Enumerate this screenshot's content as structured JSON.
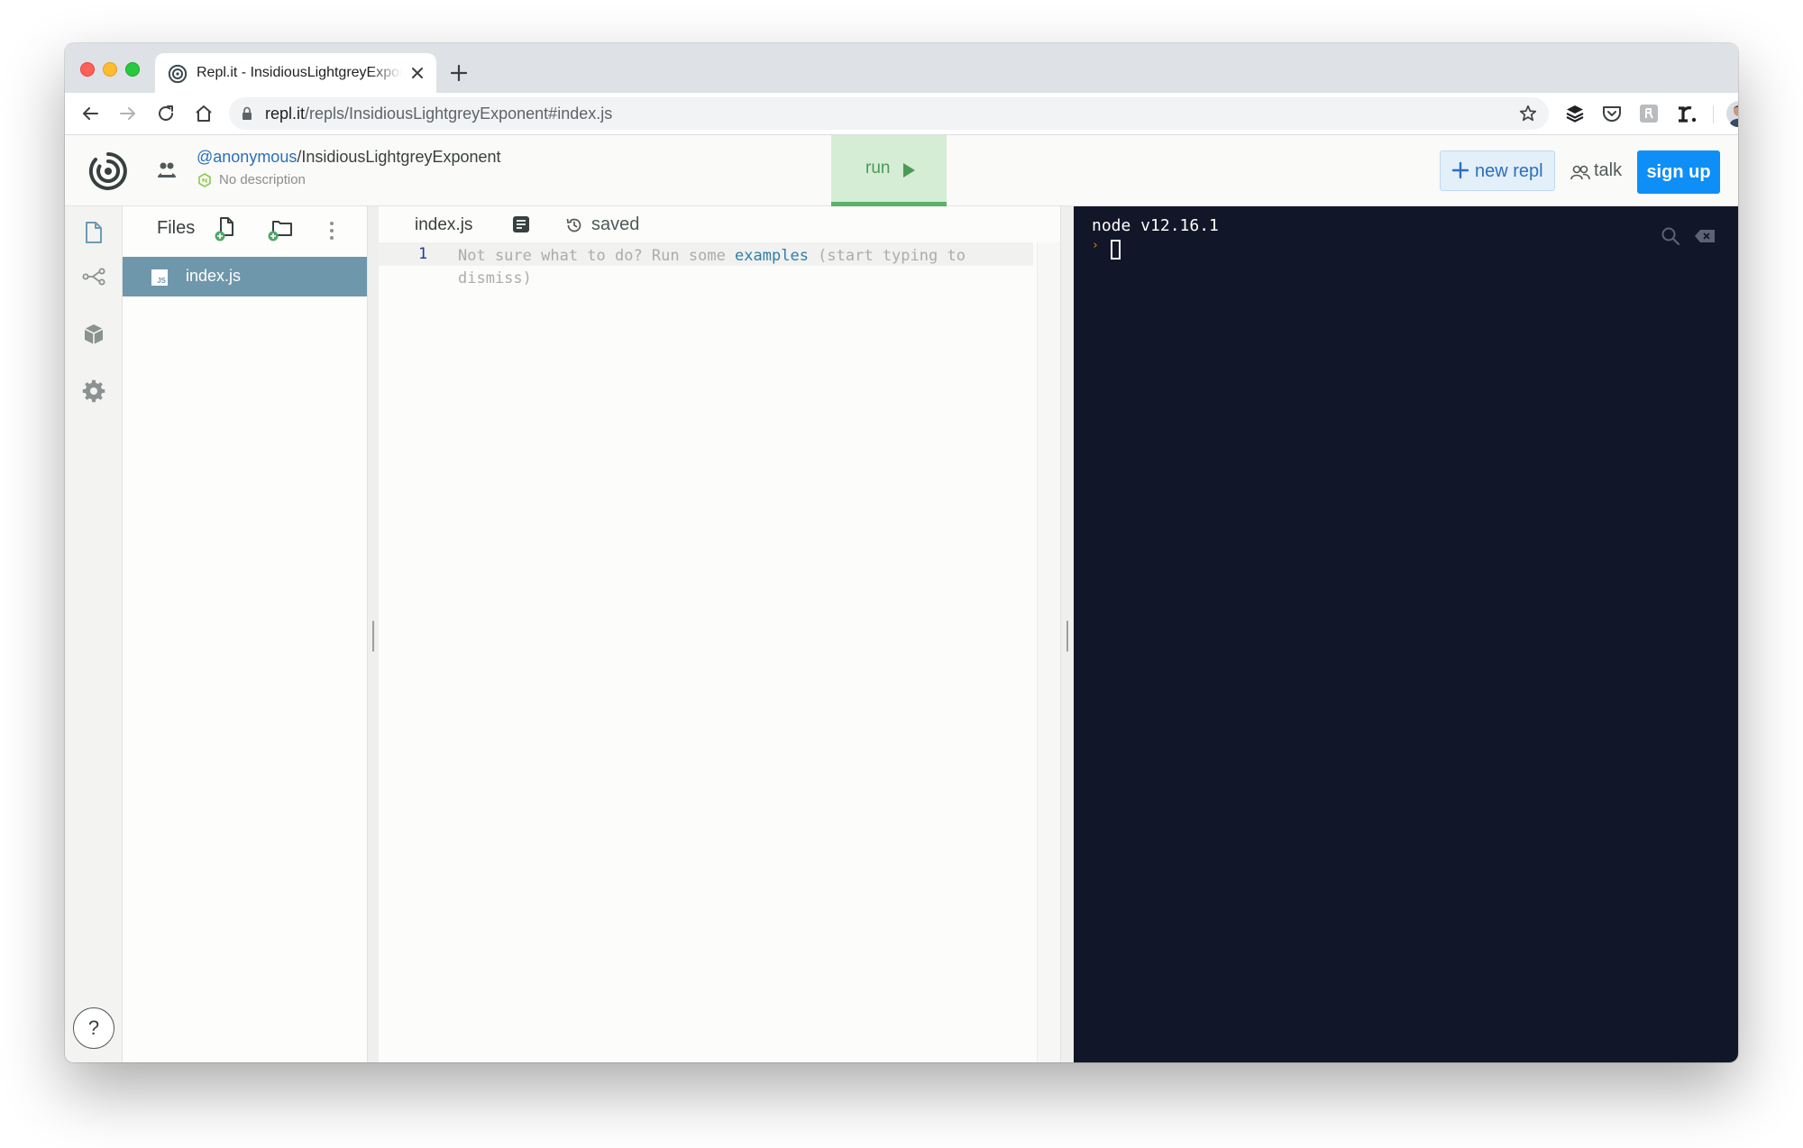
{
  "browser": {
    "tab_title": "Repl.it - InsidiousLightgreyExponent",
    "url_host": "repl.it",
    "url_path": "/repls/InsidiousLightgreyExponent#index.js"
  },
  "header": {
    "owner": "@anonymous",
    "separator": "/",
    "repl_name": "InsidiousLightgreyExponent",
    "description": "No description",
    "run_label": "run",
    "new_repl_label": "new repl",
    "talk_label": "talk",
    "sign_up_label": "sign up"
  },
  "files": {
    "title": "Files",
    "items": [
      {
        "badge": "JS",
        "name": "index.js"
      }
    ]
  },
  "editor": {
    "tab_file": "index.js",
    "status": "saved",
    "line_number": "1",
    "hint_before": "Not sure what to do? Run some ",
    "hint_link": "examples",
    "hint_after": " (start typing to dismiss)"
  },
  "console": {
    "runtime": "node v12.16.1",
    "prompt": "›"
  },
  "help": {
    "label": "?"
  },
  "colors": {
    "accent_blue": "#0e8ff7",
    "run_bg": "#d5ecd5",
    "run_green": "#5ab26b",
    "selected_file": "#6f97ab",
    "console_bg": "#111628",
    "prompt_orange": "#f07d1f"
  },
  "icons": {
    "rail": [
      "files-icon",
      "version-control-icon",
      "packages-icon",
      "settings-icon"
    ],
    "browser_extensions": [
      "buffer-icon",
      "pocket-icon",
      "ext-icon",
      "readwise-icon",
      "profile-avatar",
      "more-vertical-icon"
    ]
  }
}
